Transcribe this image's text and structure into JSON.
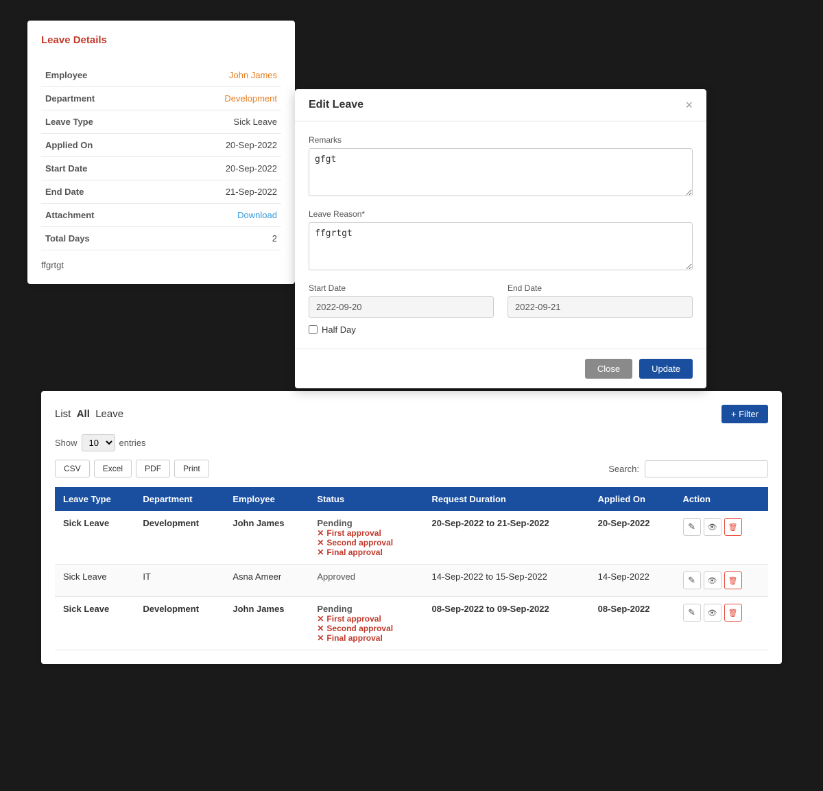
{
  "leaveDetails": {
    "title": "Leave Details",
    "fields": [
      {
        "label": "Employee",
        "value": "John James",
        "type": "orange"
      },
      {
        "label": "Department",
        "value": "Development",
        "type": "orange"
      },
      {
        "label": "Leave Type",
        "value": "Sick Leave",
        "type": "plain"
      },
      {
        "label": "Applied On",
        "value": "20-Sep-2022",
        "type": "plain"
      },
      {
        "label": "Start Date",
        "value": "20-Sep-2022",
        "type": "plain"
      },
      {
        "label": "End Date",
        "value": "21-Sep-2022",
        "type": "plain"
      },
      {
        "label": "Attachment",
        "value": "Download",
        "type": "link"
      },
      {
        "label": "Total Days",
        "value": "2",
        "type": "plain"
      }
    ],
    "remarks": "ffgrtgt"
  },
  "editLeave": {
    "title": "Edit Leave",
    "closeBtn": "×",
    "remarksLabel": "Remarks",
    "remarksValue": "gfgt",
    "leaveReasonLabel": "Leave Reason*",
    "leaveReasonValue": "ffgrtgt",
    "startDateLabel": "Start Date",
    "startDateValue": "2022-09-20",
    "endDateLabel": "End Date",
    "endDateValue": "2022-09-21",
    "halfDayLabel": "Half Day",
    "closeBtnLabel": "Close",
    "updateBtnLabel": "Update"
  },
  "leaveList": {
    "titlePrefix": "List",
    "titleBold": "All",
    "titleSuffix": "Leave",
    "filterBtn": "+ Filter",
    "showLabel": "Show",
    "showValue": "10",
    "entriesLabel": "entries",
    "exportBtns": [
      "CSV",
      "Excel",
      "PDF",
      "Print"
    ],
    "searchLabel": "Search:",
    "columns": [
      "Leave Type",
      "Department",
      "Employee",
      "Status",
      "Request Duration",
      "Applied On",
      "Action"
    ],
    "rows": [
      {
        "leaveType": "Sick Leave",
        "department": "Development",
        "employee": "John James",
        "status": "Pending",
        "statusItems": [
          "First approval",
          "Second approval",
          "Final approval"
        ],
        "duration": "20-Sep-2022 to 21-Sep-2022",
        "appliedOn": "20-Sep-2022",
        "bold": true
      },
      {
        "leaveType": "Sick Leave",
        "department": "IT",
        "employee": "Asna Ameer",
        "status": "Approved",
        "statusItems": [],
        "duration": "14-Sep-2022 to 15-Sep-2022",
        "appliedOn": "14-Sep-2022",
        "bold": false
      },
      {
        "leaveType": "Sick Leave",
        "department": "Development",
        "employee": "John James",
        "status": "Pending",
        "statusItems": [
          "First approval",
          "Second approval",
          "Final approval"
        ],
        "duration": "08-Sep-2022 to 09-Sep-2022",
        "appliedOn": "08-Sep-2022",
        "bold": true
      }
    ]
  }
}
